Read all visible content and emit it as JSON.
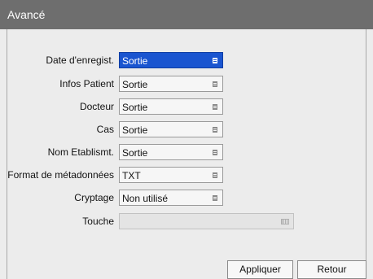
{
  "window": {
    "title": "Avancé"
  },
  "form": {
    "rows": [
      {
        "label": "Date d'enregist.",
        "value": "Sortie"
      },
      {
        "label": "Infos Patient",
        "value": "Sortie"
      },
      {
        "label": "Docteur",
        "value": "Sortie"
      },
      {
        "label": "Cas",
        "value": "Sortie"
      },
      {
        "label": "Nom Etablismt.",
        "value": "Sortie"
      },
      {
        "label": "Format de métadonnées",
        "value": "TXT"
      },
      {
        "label": "Cryptage",
        "value": "Non utilisé"
      }
    ],
    "key": {
      "label": "Touche",
      "value": ""
    }
  },
  "buttons": {
    "apply": "Appliquer",
    "back": "Retour"
  },
  "colors": {
    "titlebar": "#6e6e6e",
    "selected": "#1a55d0",
    "background": "#ececec"
  }
}
